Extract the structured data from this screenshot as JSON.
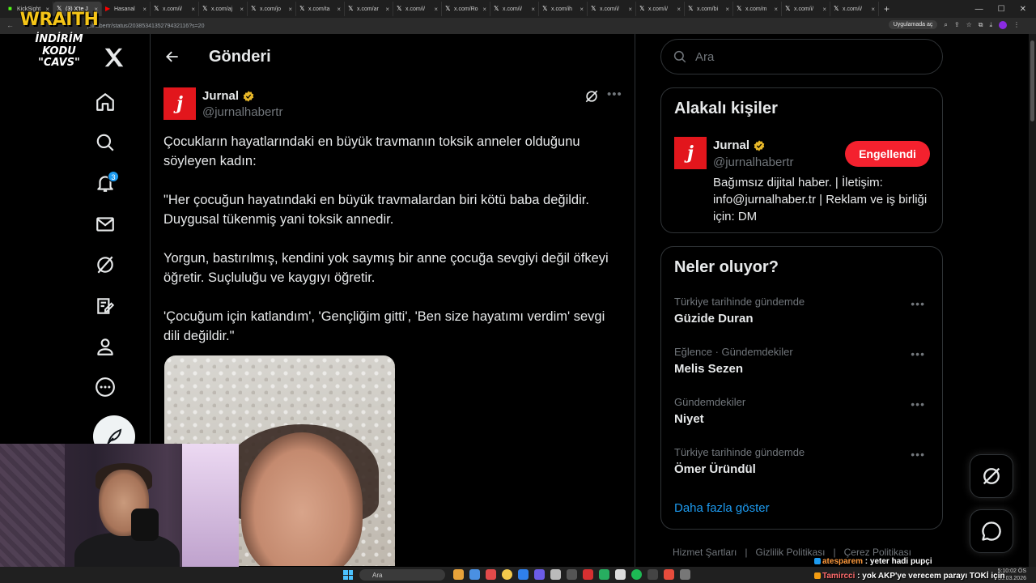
{
  "browser": {
    "tabs": [
      {
        "label": "KickSight",
        "icon": "kick-icon",
        "active": false
      },
      {
        "label": "(3) X'te J",
        "icon": "x-icon",
        "active": true
      },
      {
        "label": "Hasanal",
        "icon": "youtube-icon",
        "active": false
      },
      {
        "label": "x.com/i/",
        "icon": "x-icon",
        "active": false
      },
      {
        "label": "x.com/aj",
        "icon": "x-icon",
        "active": false
      },
      {
        "label": "x.com/jo",
        "icon": "x-icon",
        "active": false
      },
      {
        "label": "x.com/ta",
        "icon": "x-icon",
        "active": false
      },
      {
        "label": "x.com/ar",
        "icon": "x-icon",
        "active": false
      },
      {
        "label": "x.com/i/",
        "icon": "x-icon",
        "active": false
      },
      {
        "label": "x.com/Ro",
        "icon": "x-icon",
        "active": false
      },
      {
        "label": "x.com/i/",
        "icon": "x-icon",
        "active": false
      },
      {
        "label": "x.com/ih",
        "icon": "x-icon",
        "active": false
      },
      {
        "label": "x.com/i/",
        "icon": "x-icon",
        "active": false
      },
      {
        "label": "x.com/i/",
        "icon": "x-icon",
        "active": false
      },
      {
        "label": "x.com/bi",
        "icon": "x-icon",
        "active": false
      },
      {
        "label": "x.com/m",
        "icon": "x-icon",
        "active": false
      },
      {
        "label": "x.com/i/",
        "icon": "x-icon",
        "active": false
      },
      {
        "label": "x.com/i/",
        "icon": "x-icon",
        "active": false
      }
    ],
    "url": "jalhabertr/status/2038534135279432116?s=20",
    "app_button": "Uygulamada aç"
  },
  "overlay": {
    "brand": "WRAITH",
    "promo_line1": "İNDİRİM KODU",
    "promo_line2": "\"CAVS\""
  },
  "nav": {
    "notifications_badge": "3",
    "items": [
      "home-icon",
      "search-icon",
      "bell-icon",
      "mail-icon",
      "grok-icon",
      "compose-list-icon",
      "profile-icon",
      "more-icon"
    ]
  },
  "main": {
    "title": "Gönderi",
    "post": {
      "author_name": "Jurnal",
      "author_handle": "@jurnalhabertr",
      "avatar_letter": "j",
      "paragraphs": [
        "Çocukların hayatlarındaki en büyük travmanın toksik anneler olduğunu söyleyen kadın:",
        "\"Her çocuğun hayatındaki en büyük travmalardan biri kötü baba değildir. Duygusal tükenmiş yani toksik annedir.",
        "Yorgun, bastırılmış, kendini yok saymış bir anne çocuğa sevgiyi değil öfkeyi öğretir. Suçluluğu ve kaygıyı öğretir.",
        "'Çocuğum için katlandım', 'Gençliğim gitti', 'Ben size hayatımı verdim' sevgi dili değildir.\""
      ]
    }
  },
  "sidebar": {
    "search_placeholder": "Ara",
    "relevant": {
      "title": "Alakalı kişiler",
      "name": "Jurnal",
      "handle": "@jurnalhabertr",
      "bio": "Bağımsız dijital haber. | İletişim: info@jurnalhaber.tr | Reklam ve iş birliği için: DM",
      "button": "Engellendi"
    },
    "trends": {
      "title": "Neler oluyor?",
      "items": [
        {
          "category": "Türkiye tarihinde gündemde",
          "name": "Güzide Duran"
        },
        {
          "category": "Eğlence · Gündemdekiler",
          "name": "Melis Sezen"
        },
        {
          "category": "Gündemdekiler",
          "name": "Niyet"
        },
        {
          "category": "Türkiye tarihinde gündemde",
          "name": "Ömer Üründül"
        }
      ],
      "show_more": "Daha fazla göster"
    },
    "footer": [
      "Hizmet Şartları",
      "Gizlilik Politikası",
      "Çerez Politikası"
    ]
  },
  "taskbar": {
    "search_label": "Ara",
    "time": "5:10:02 ÖS",
    "date": "30.03.2026"
  },
  "chat": [
    {
      "user": "atesparem",
      "message": " : yeter hadi pupçi"
    },
    {
      "user": "Tamircci",
      "message": " : yok AKP'ye verecem parayı TOKİ için"
    }
  ],
  "colors": {
    "accent": "#1d9bf0",
    "blocked": "#f4212e",
    "brand_red": "#e2161c",
    "verified": "#e8b829"
  }
}
